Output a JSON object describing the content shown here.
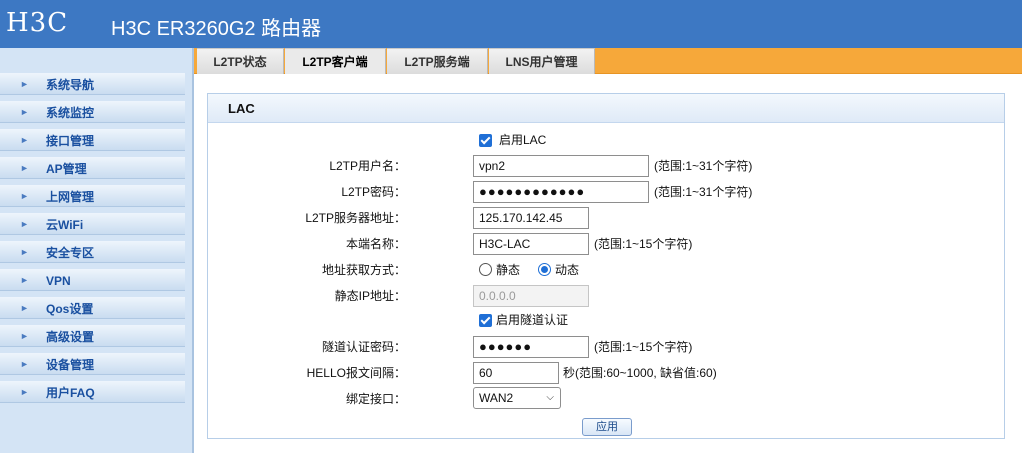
{
  "header": {
    "logo": "H3C",
    "title": "H3C ER3260G2 路由器",
    "bg": "#3d78c3"
  },
  "sidebar": {
    "items": [
      {
        "label": "系统导航"
      },
      {
        "label": "系统监控"
      },
      {
        "label": "接口管理"
      },
      {
        "label": "AP管理"
      },
      {
        "label": "上网管理"
      },
      {
        "label": "云WiFi"
      },
      {
        "label": "安全专区"
      },
      {
        "label": "VPN"
      },
      {
        "label": "Qos设置"
      },
      {
        "label": "高级设置"
      },
      {
        "label": "设备管理"
      },
      {
        "label": "用户FAQ"
      }
    ]
  },
  "tabs": [
    {
      "label": "L2TP状态"
    },
    {
      "label": "L2TP客户端",
      "active": true
    },
    {
      "label": "L2TP服务端"
    },
    {
      "label": "LNS用户管理"
    }
  ],
  "panel": {
    "title": "LAC",
    "enable_lac": {
      "label": "启用LAC",
      "checked": true
    },
    "username": {
      "label": "L2TP用户名：",
      "value": "vpn2",
      "hint": "(范围:1~31个字符)"
    },
    "password": {
      "label": "L2TP密码：",
      "value": "●●●●●●●●●●●●",
      "hint": "(范围:1~31个字符)"
    },
    "server_addr": {
      "label": "L2TP服务器地址：",
      "value": "125.170.142.45"
    },
    "local_name": {
      "label": "本端名称：",
      "value": "H3C-LAC",
      "hint": "(范围:1~15个字符)"
    },
    "addr_mode": {
      "label": "地址获取方式：",
      "options": [
        "静态",
        "动态"
      ],
      "selected": "动态"
    },
    "static_ip": {
      "label": "静态IP地址：",
      "value": "0.0.0.0"
    },
    "tunnel_auth": {
      "label": "启用隧道认证",
      "checked": true
    },
    "tunnel_pwd": {
      "label": "隧道认证密码：",
      "value": "●●●●●●",
      "hint": "(范围:1~15个字符)"
    },
    "hello": {
      "label": "HELLO报文间隔：",
      "value": "60",
      "hint": "秒(范围:60~1000, 缺省值:60)"
    },
    "bind_if": {
      "label": "绑定接口：",
      "value": "WAN2"
    },
    "apply_label": "应用"
  }
}
